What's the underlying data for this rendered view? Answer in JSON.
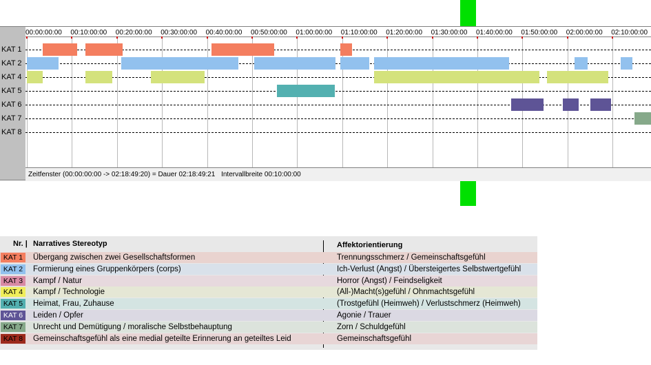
{
  "timeline": {
    "ticks": [
      "00:00:00:00",
      "00:10:00:00",
      "00:20:00:00",
      "00:30:00:00",
      "00:40:00:00",
      "00:50:00:00",
      "01:00:00:00",
      "01:10:00:00",
      "01:20:00:00",
      "01:30:00:00",
      "01:40:00:00",
      "01:50:00:00",
      "02:00:00:00",
      "02:10:00:00"
    ],
    "rows": [
      {
        "label": "KAT 1",
        "color": "#f47e5f",
        "segments": [
          [
            "00:03:30",
            "00:11:10"
          ],
          [
            "00:13:00",
            "00:21:15"
          ],
          [
            "00:41:00",
            "00:54:50"
          ],
          [
            "01:09:30",
            "01:12:10"
          ]
        ]
      },
      {
        "label": "KAT 2",
        "color": "#92c1ee",
        "segments": [
          [
            "00:00:00",
            "00:07:05"
          ],
          [
            "00:21:00",
            "00:47:00"
          ],
          [
            "00:50:30",
            "01:08:30"
          ],
          [
            "01:09:30",
            "01:16:00"
          ],
          [
            "01:17:00",
            "01:47:00"
          ],
          [
            "02:01:30",
            "02:04:30"
          ],
          [
            "02:11:50",
            "02:14:20"
          ]
        ]
      },
      {
        "label": "KAT 4",
        "color": "#d4e27c",
        "segments": [
          [
            "00:00:00",
            "00:03:30"
          ],
          [
            "00:13:00",
            "00:19:00"
          ],
          [
            "00:27:30",
            "00:39:30"
          ],
          [
            "01:17:00",
            "01:53:50"
          ],
          [
            "01:55:30",
            "02:09:00"
          ]
        ]
      },
      {
        "label": "KAT 5",
        "color": "#53b0b0",
        "segments": [
          [
            "00:55:30",
            "01:08:20"
          ]
        ]
      },
      {
        "label": "KAT 6",
        "color": "#5e5496",
        "segments": [
          [
            "01:47:30",
            "01:54:40"
          ],
          [
            "01:59:00",
            "02:02:30"
          ],
          [
            "02:05:00",
            "02:09:40"
          ]
        ]
      },
      {
        "label": "KAT 7",
        "color": "#86a98a",
        "segments": [
          [
            "02:14:50",
            "02:18:49"
          ]
        ]
      },
      {
        "label": "KAT 8",
        "color": "#9c2a1c",
        "segments": []
      }
    ],
    "status": {
      "window": "Zeitfenster (00:00:00:00 -> 02:18:49:20) = Dauer 02:18:49:21",
      "interval": "Intervallbreite 00:10:00:00"
    }
  },
  "legend": {
    "col_nr": "Nr. |",
    "col_stereotype": "Narratives Stereotyp",
    "col_affect": "Affektorientierung",
    "items": [
      {
        "cat": "KAT 1",
        "color": "#f47e5f",
        "text_color": "#000000",
        "row_bg": "#e9d3cf",
        "stereotype": "Übergang zwischen zwei Gesellschaftsformen",
        "affect": "Trennungsschmerz / Gemeinschaftsgefühl"
      },
      {
        "cat": "KAT 2",
        "color": "#92c1ee",
        "text_color": "#000000",
        "row_bg": "#d9e1ea",
        "stereotype": "Formierung eines Gruppenkörpers (corps)",
        "affect": "Ich-Verlust (Angst) / Übersteigertes Selbstwertgefühl"
      },
      {
        "cat": "KAT 3",
        "color": "#d88aa4",
        "text_color": "#000000",
        "row_bg": "#e7d9de",
        "stereotype": "Kampf / Natur",
        "affect": "Horror (Angst) / Feindseligkeit"
      },
      {
        "cat": "KAT 4",
        "color": "#f0ee5a",
        "text_color": "#000000",
        "row_bg": "#e5e7d5",
        "stereotype": "Kampf / Technologie",
        "affect": "(All-)Macht(s)gefühl / Ohnmachtsgefühl"
      },
      {
        "cat": "KAT 5",
        "color": "#53b0b0",
        "text_color": "#000000",
        "row_bg": "#d4e4e2",
        "stereotype": "Heimat, Frau, Zuhause",
        "affect": "(Trostgefühl (Heimweh) / Verlustschmerz (Heimweh)"
      },
      {
        "cat": "KAT 6",
        "color": "#5e5496",
        "text_color": "#ffffff",
        "row_bg": "#dbd9e3",
        "stereotype": "Leiden / Opfer",
        "affect": "Agonie / Trauer"
      },
      {
        "cat": "KAT 7",
        "color": "#86a98a",
        "text_color": "#000000",
        "row_bg": "#dce3dc",
        "stereotype": "Unrecht und Demütigung / moralische Selbstbehauptung",
        "affect": "Zorn / Schuldgefühl"
      },
      {
        "cat": "KAT 8",
        "color": "#9c2a1c",
        "text_color": "#000000",
        "row_bg": "#e8d5d5",
        "stereotype": "Gemeinschaftsgefühl als eine medial geteilte Erinnerung an geteiltes Leid",
        "affect": "Gemeinschaftsgefühl"
      }
    ]
  }
}
